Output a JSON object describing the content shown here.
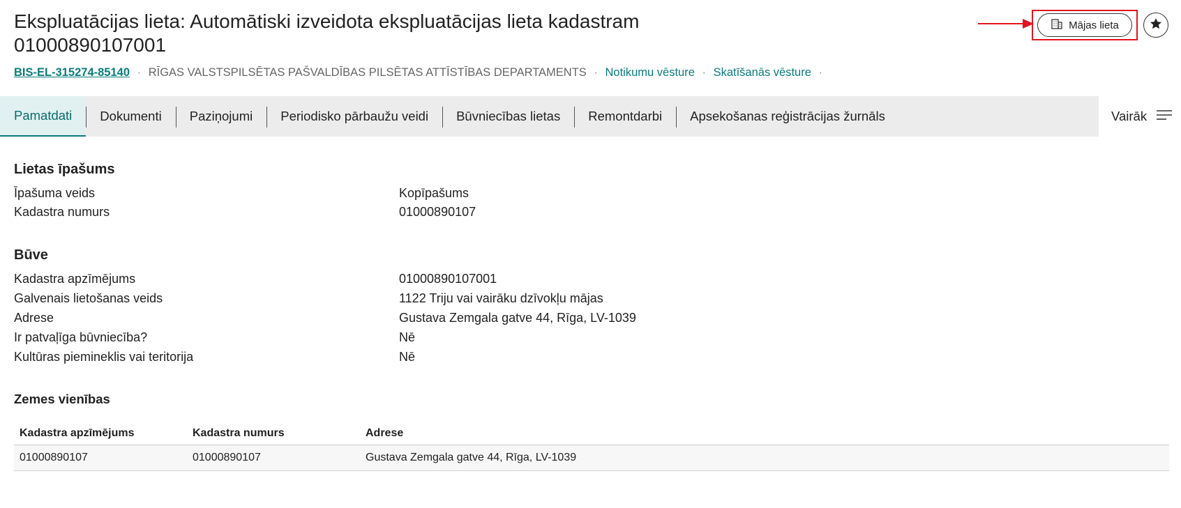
{
  "header": {
    "title": "Ekspluatācijas lieta: Automātiski izveidota ekspluatācijas lieta kadastram 01000890107001",
    "case_id": "BIS-EL-315274-85140",
    "separator": "·",
    "department": "RĪGAS VALSTSPILSĒTAS PAŠVALDĪBAS PILSĒTAS ATTĪSTĪBAS DEPARTAMENTS",
    "event_history": "Notikumu vēsture",
    "view_history": "Skatīšanās vēsture"
  },
  "actions": {
    "house_case_label": "Mājas lieta",
    "house_icon": "building-icon",
    "favorite_icon": "star-icon",
    "highlight_color": "#e0141e"
  },
  "tabs": [
    {
      "label": "Pamatdati",
      "active": true
    },
    {
      "label": "Dokumenti"
    },
    {
      "label": "Paziņojumi"
    },
    {
      "label": "Periodisko pārbaužu veidi"
    },
    {
      "label": "Būvniecības lietas"
    },
    {
      "label": "Remontdarbi"
    },
    {
      "label": "Apsekošanas reģistrācijas žurnāls"
    }
  ],
  "more": {
    "label": "Vairāk",
    "icon": "menu-lines-icon"
  },
  "property": {
    "title": "Lietas īpašums",
    "rows": [
      {
        "label": "Īpašuma veids",
        "value": "Kopīpašums"
      },
      {
        "label": "Kadastra numurs",
        "value": "01000890107"
      }
    ]
  },
  "building": {
    "title": "Būve",
    "rows": [
      {
        "label": "Kadastra apzīmējums",
        "value": "01000890107001"
      },
      {
        "label": "Galvenais lietošanas veids",
        "value": "1122 Triju vai vairāku dzīvokļu mājas"
      },
      {
        "label": "Adrese",
        "value": "Gustava Zemgala gatve 44, Rīga, LV-1039"
      },
      {
        "label": "Ir patvaļīga būvniecība?",
        "value": "Nē"
      },
      {
        "label": "Kultūras piemineklis vai teritorija",
        "value": "Nē"
      }
    ]
  },
  "land": {
    "title": "Zemes vienības",
    "columns": [
      "Kadastra apzīmējums",
      "Kadastra numurs",
      "Adrese"
    ],
    "rows": [
      [
        "01000890107",
        "01000890107",
        "Gustava Zemgala gatve 44, Rīga, LV-1039"
      ]
    ]
  },
  "colors": {
    "accent": "#0a7c7c",
    "tabbar": "#ececec"
  }
}
